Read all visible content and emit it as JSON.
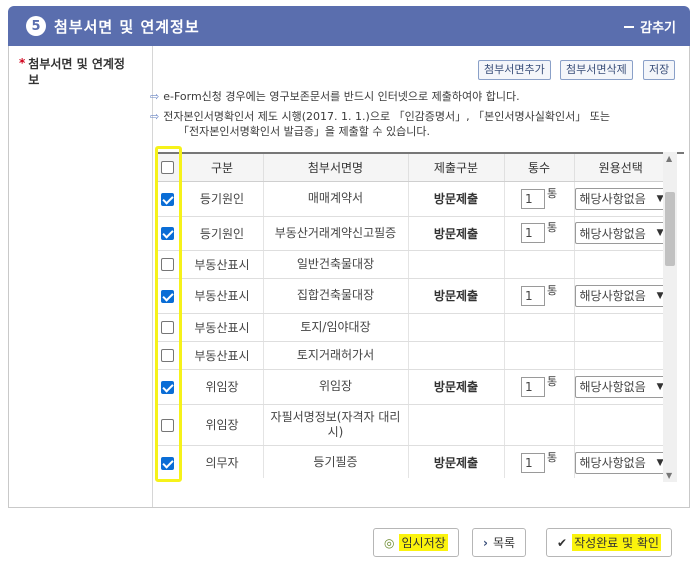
{
  "header": {
    "step": "5",
    "title": "첨부서면 및 연계정보",
    "collapse_label": "감추기"
  },
  "side": {
    "label": "첨부서면 및 연계정보"
  },
  "actions": {
    "add": "첨부서면추가",
    "delete": "첨부서면삭제",
    "save": "저장"
  },
  "notes": [
    "e-Form신청 경우에는 영구보존문서를 반드시 인터넷으로 제출하여야 합니다.",
    "전자본인서명확인서 제도 시행(2017. 1. 1.)으로 「인감증명서」, 「본인서명사실확인서」 또는",
    "「전자본인서명확인서 발급증」을 제출할 수 있습니다."
  ],
  "table": {
    "headers": [
      "구분",
      "첨부서면명",
      "제출구분",
      "통수",
      "원용선택"
    ],
    "rows": [
      {
        "checked": true,
        "type": "등기원인",
        "name": "매매계약서",
        "submit": "방문제출",
        "count": "1",
        "select": "해당사항없음"
      },
      {
        "checked": true,
        "type": "등기원인",
        "name": "부동산거래계약신고필증",
        "submit": "방문제출",
        "count": "1",
        "select": "해당사항없음"
      },
      {
        "checked": false,
        "type": "부동산표시",
        "name": "일반건축물대장",
        "submit": "",
        "count": "",
        "select": ""
      },
      {
        "checked": true,
        "type": "부동산표시",
        "name": "집합건축물대장",
        "submit": "방문제출",
        "count": "1",
        "select": "해당사항없음"
      },
      {
        "checked": false,
        "type": "부동산표시",
        "name": "토지/임야대장",
        "submit": "",
        "count": "",
        "select": ""
      },
      {
        "checked": false,
        "type": "부동산표시",
        "name": "토지거래허가서",
        "submit": "",
        "count": "",
        "select": ""
      },
      {
        "checked": true,
        "type": "위임장",
        "name": "위임장",
        "submit": "방문제출",
        "count": "1",
        "select": "해당사항없음"
      },
      {
        "checked": false,
        "type": "위임장",
        "name": "자필서명정보(자격자 대리 시)",
        "submit": "",
        "count": "",
        "select": ""
      },
      {
        "checked": true,
        "type": "의무자",
        "name": "등기필증",
        "submit": "방문제출",
        "count": "1",
        "select": "해당사항없음"
      }
    ],
    "count_unit": "통"
  },
  "bottom": {
    "temp_save": "임시저장",
    "list": "목록",
    "complete": "작성완료 및 확인"
  },
  "colors": {
    "header_bg": "#5a6eae",
    "highlight": "#f6f21a",
    "checkbox_on": "#0a6dd6"
  },
  "icons": {
    "temp_save": "circle-icon",
    "list": "chevron-right-icon",
    "complete": "check-icon",
    "select": "chevron-down-icon"
  }
}
